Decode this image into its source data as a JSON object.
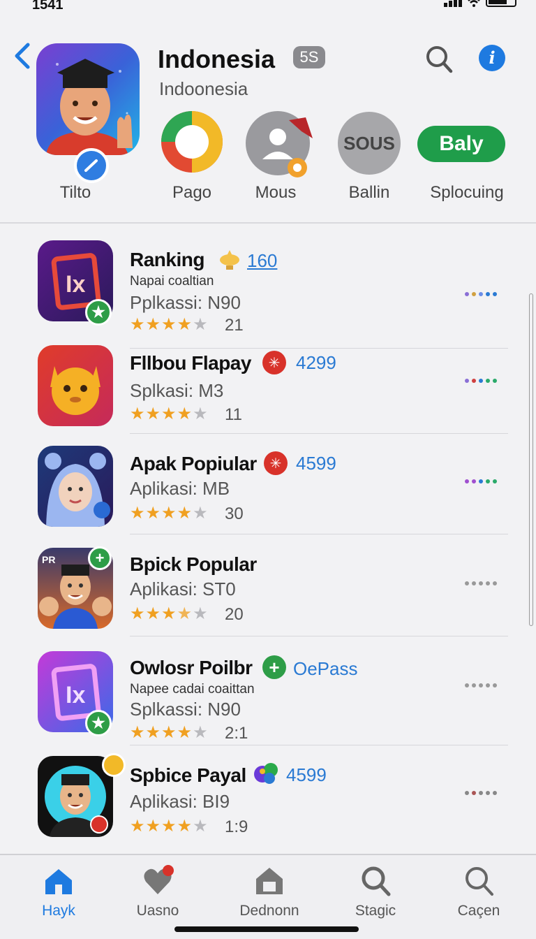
{
  "status": {
    "time": "1541"
  },
  "header": {
    "title": "Indonesia",
    "age_rating": "5S",
    "subtitle": "Indoonesia",
    "app_icon_label": "Tilto",
    "categories": [
      {
        "label": "Pago",
        "icon": "chrome-style-ring-icon"
      },
      {
        "label": "Mous",
        "icon": "profile-graduate-icon"
      },
      {
        "label": "Ballin",
        "icon": "sous-circle-icon",
        "text": "SOUS"
      },
      {
        "label": "Splocuing",
        "icon": "pill-button",
        "text": "Baly"
      }
    ]
  },
  "list": {
    "items": [
      {
        "name": "Ranking",
        "tag": "160",
        "tag_icon": "lightbulb-icon",
        "desc": "Napai coaltian",
        "meta": "Pplkassi: N90",
        "stars": 4,
        "count": "21",
        "dots": [
          "#8a6fd6",
          "#d0a040",
          "#6a8ee8",
          "#2a7ad3",
          "#2a7ad3"
        ]
      },
      {
        "name": "Fllbou Flapay",
        "tag": "4299",
        "tag_icon": "burst-red-icon",
        "desc": "",
        "meta": "Splkasi: M3",
        "stars": 4,
        "count": "11",
        "dots": [
          "#8a6fd6",
          "#d04040",
          "#2a7ad3",
          "#2aaa6a",
          "#2aaa6a"
        ]
      },
      {
        "name": "Apak Popiular",
        "tag": "4599",
        "tag_icon": "burst-red-icon",
        "desc": "",
        "meta": "Aplikasi: MB",
        "stars": 4,
        "count": "30",
        "dots": [
          "#a050d0",
          "#a050d0",
          "#2a7ad3",
          "#2aaa6a",
          "#2aaa6a"
        ]
      },
      {
        "name": "Bpick Popular",
        "tag": "",
        "tag_icon": "",
        "desc": "",
        "meta": "Aplikasi: ST0",
        "stars": 3.5,
        "count": "20",
        "dots": [
          "#999",
          "#999",
          "#999",
          "#999",
          "#999"
        ]
      },
      {
        "name": "Owlosr Poilbr",
        "tag": "OePass",
        "tag_icon": "plus-green-icon",
        "desc": "Napee cadai coaittan",
        "meta": "Splkassi: N90",
        "stars": 4,
        "count": "2:1",
        "dots": [
          "#999",
          "#999",
          "#999",
          "#999",
          "#999"
        ]
      },
      {
        "name": "Spbice Payal",
        "tag": "4599",
        "tag_icon": "colorful-blob-icon",
        "desc": "",
        "meta": "Aplikasi: BI9",
        "stars": 4,
        "count": "1:9",
        "dots": [
          "#888",
          "#a55",
          "#888",
          "#888",
          "#888"
        ]
      }
    ]
  },
  "tabs": [
    {
      "label": "Hayk",
      "icon": "home-icon",
      "active": true
    },
    {
      "label": "Uasno",
      "icon": "heart-icon",
      "active": false
    },
    {
      "label": "Dednonn",
      "icon": "house-lock-icon",
      "active": false
    },
    {
      "label": "Stagic",
      "icon": "search-icon",
      "active": false
    },
    {
      "label": "Caçen",
      "icon": "search-icon",
      "active": false
    }
  ],
  "colors": {
    "accent": "#1e7ae0",
    "star": "#f0a021",
    "green": "#1f9d4a"
  }
}
